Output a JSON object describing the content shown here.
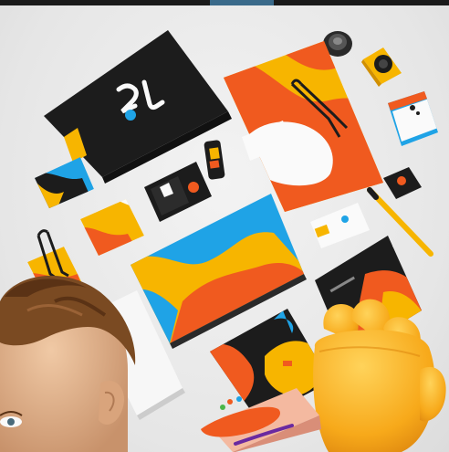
{
  "scene": {
    "description_label": "",
    "brand_mark": "2L",
    "palette": {
      "black": "#1c1c1c",
      "orange": "#f05a1f",
      "yellow": "#f7b500",
      "blue": "#1fa3e6",
      "white": "#fafafa",
      "background": "#e9e9e9"
    }
  }
}
